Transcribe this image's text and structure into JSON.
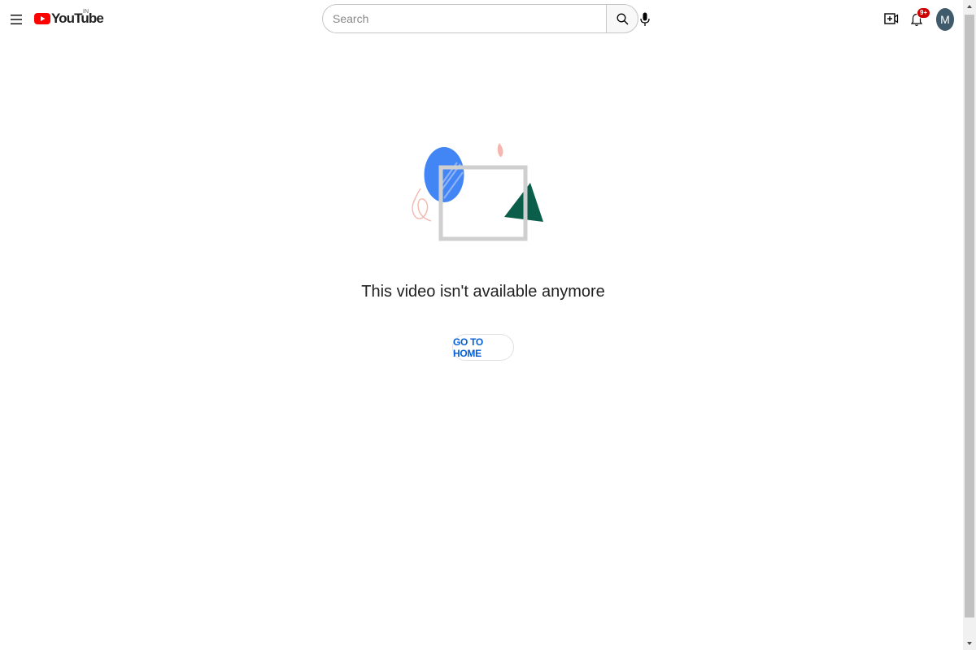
{
  "masthead": {
    "logo_text": "YouTube",
    "region_code": "IN",
    "notification_count": "9+",
    "avatar_letter": "M"
  },
  "search": {
    "placeholder": "Search",
    "value": ""
  },
  "main": {
    "message": "This video isn't available anymore",
    "home_button_label": "GO TO HOME"
  },
  "colors": {
    "brand_red": "#ff0000",
    "link_blue": "#065fd4",
    "illustration_blue": "#4285f4",
    "illustration_green": "#0b5e4a",
    "illustration_pink": "#f4b6ae",
    "illustration_frame": "#cfcfcf",
    "avatar_bg": "#3e5a6b",
    "badge_red": "#cc0000"
  },
  "icons": {
    "menu": "hamburger-menu-icon",
    "search": "search-icon",
    "mic": "microphone-icon",
    "create": "create-video-icon",
    "notifications": "bell-icon"
  }
}
